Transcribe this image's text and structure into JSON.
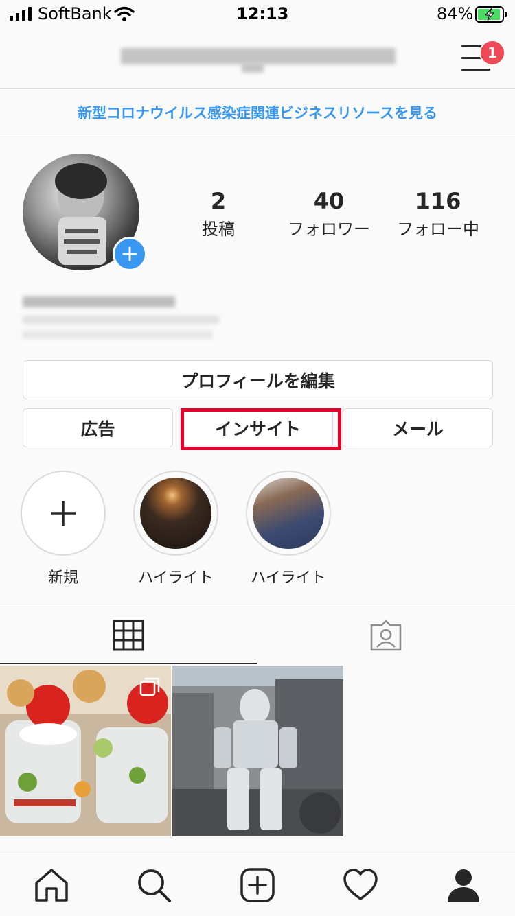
{
  "status_bar": {
    "carrier": "SoftBank",
    "time": "12:13",
    "battery": "84%"
  },
  "header": {
    "notification_count": "1"
  },
  "banner": {
    "text": "新型コロナウイルス感染症関連ビジネスリソースを見る"
  },
  "profile": {
    "stats": [
      {
        "value": "2",
        "label": "投稿"
      },
      {
        "value": "40",
        "label": "フォロワー"
      },
      {
        "value": "116",
        "label": "フォロー中"
      }
    ]
  },
  "buttons": {
    "edit_profile": "プロフィールを編集",
    "ads": "広告",
    "insights": "インサイト",
    "mail": "メール"
  },
  "highlights": [
    {
      "label": "新規"
    },
    {
      "label": "ハイライト"
    },
    {
      "label": "ハイライト"
    }
  ],
  "colors": {
    "accent_blue": "#3897f0",
    "badge_red": "#ed4956",
    "annotation_red": "#e8002d"
  },
  "icons": [
    "wifi-icon",
    "battery-charging-icon",
    "menu-icon",
    "plus-icon",
    "grid-icon",
    "tagged-icon",
    "home-icon",
    "search-icon",
    "new-post-icon",
    "heart-icon",
    "profile-icon"
  ]
}
